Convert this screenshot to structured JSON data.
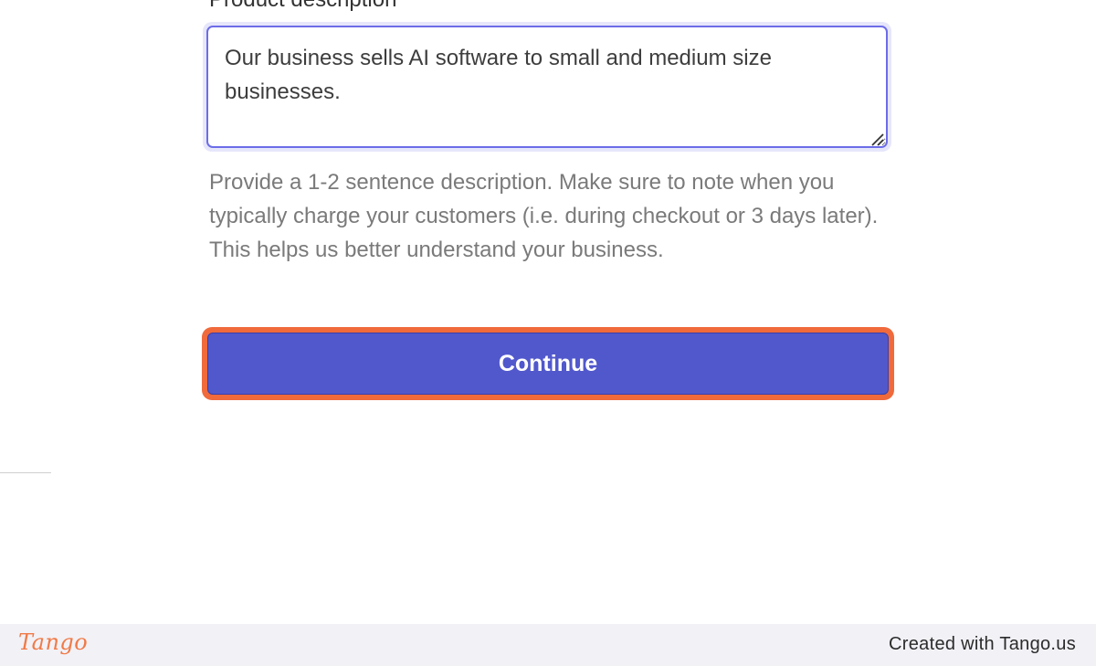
{
  "form": {
    "field_label": "Product description",
    "description_value": "Our business sells AI software to small and medium size businesses.",
    "helper_text": "Provide a 1-2 sentence description. Make sure to note when you typically charge your customers (i.e. during checkout or 3 days later). This helps us better understand your business.",
    "continue_label": "Continue"
  },
  "footer": {
    "logo_text": "Tango",
    "credit_text": "Created with Tango.us"
  },
  "colors": {
    "accent": "#5158cc",
    "highlight": "#f06a3c",
    "focus_ring": "#6c6ce8",
    "logo": "#f07a47"
  },
  "icons": {
    "resize_handle": "resize-handle-icon"
  }
}
